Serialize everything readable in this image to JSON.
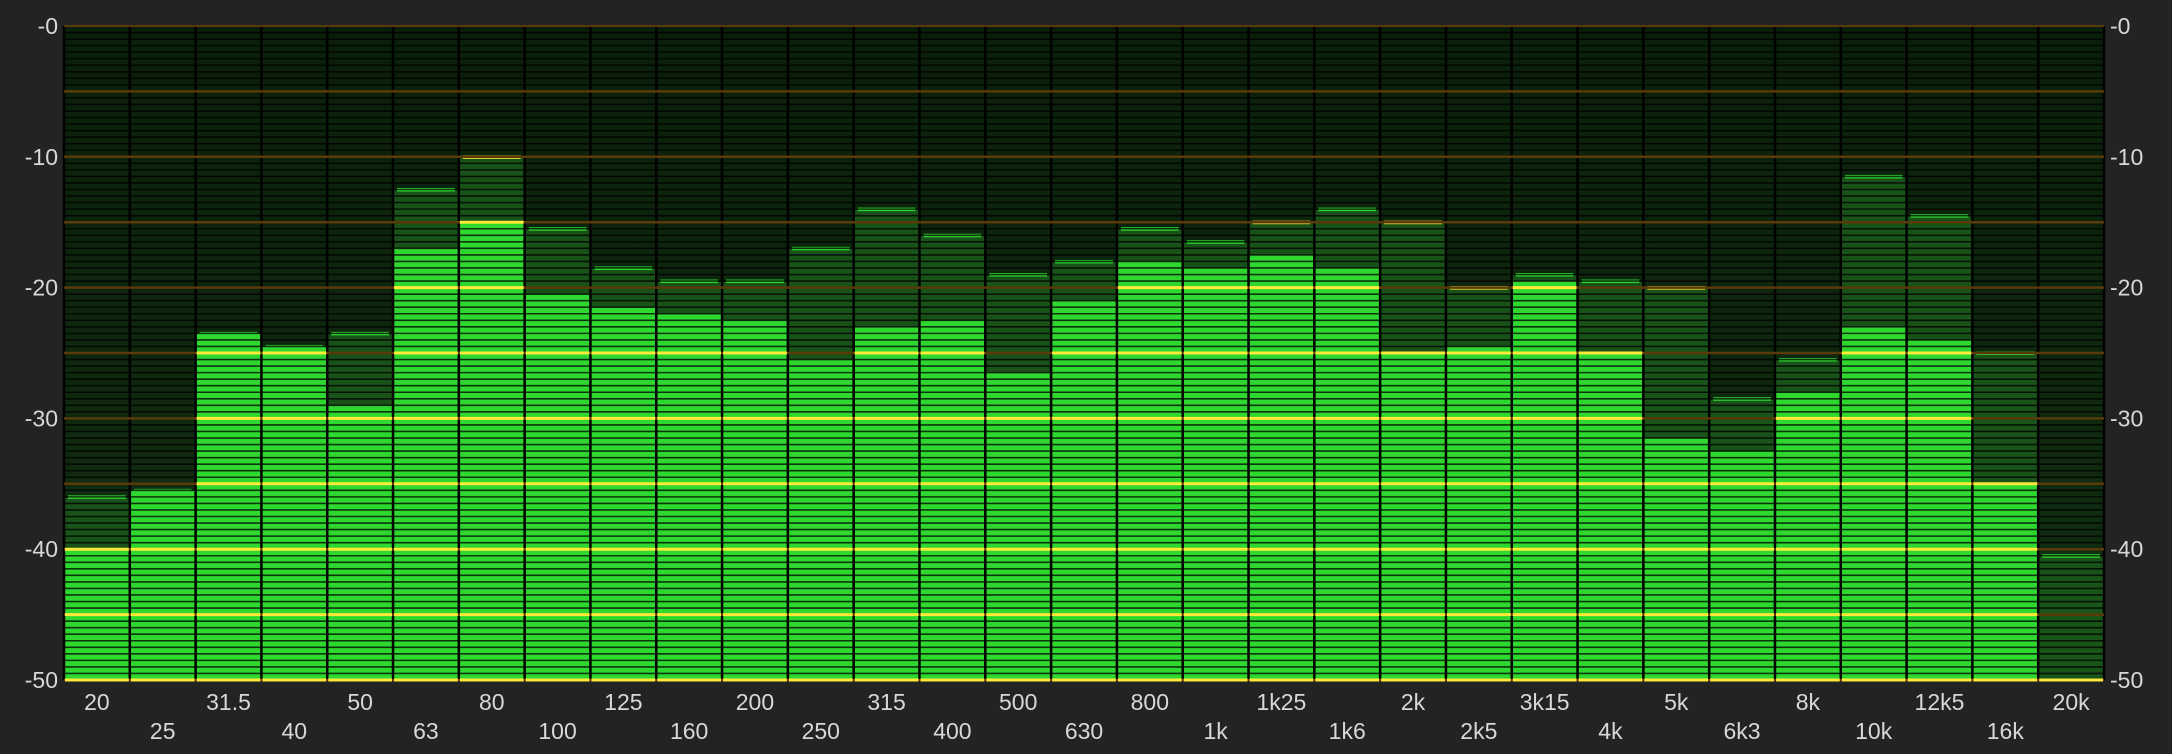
{
  "chart_data": {
    "type": "bar",
    "ylim": [
      -50,
      0
    ],
    "y_ticks": [
      0,
      -10,
      -20,
      -30,
      -40,
      -50
    ],
    "y_tick_labels": [
      "-0",
      "-10",
      "-20",
      "-30",
      "-40",
      "-50"
    ],
    "categories": [
      "20",
      "25",
      "31.5",
      "40",
      "50",
      "63",
      "80",
      "100",
      "125",
      "160",
      "200",
      "250",
      "315",
      "400",
      "500",
      "630",
      "800",
      "1k",
      "1k25",
      "1k6",
      "2k",
      "2k5",
      "3k15",
      "4k",
      "5k",
      "6k3",
      "8k",
      "10k",
      "12k5",
      "16k",
      "20k"
    ],
    "series": [
      {
        "values": [
          -40,
          -35.5,
          -23.5,
          -24.5,
          -29,
          -17,
          -15,
          -20.5,
          -21.5,
          -22,
          -22.5,
          -25.5,
          -23,
          -22.5,
          -26.5,
          -21,
          -18,
          -18.5,
          -17.5,
          -18.5,
          -25,
          -24.5,
          -19.5,
          -25,
          -31.5,
          -32.5,
          -28,
          -23,
          -24,
          -35,
          -50
        ]
      },
      {
        "values": [
          -36,
          -35.5,
          -23.5,
          -24.5,
          -23.5,
          -12.5,
          -10,
          -15.5,
          -18.5,
          -19.5,
          -19.5,
          -17,
          -14,
          -16,
          -19,
          -18,
          -15.5,
          -16.5,
          -15,
          -14,
          -15,
          -20,
          -19,
          -19.5,
          -20,
          -28.5,
          -25.5,
          -11.5,
          -14.5,
          -25,
          -40.5
        ]
      }
    ],
    "colors": {
      "background": "#232323",
      "lit": "#2fd82f",
      "hold": "#2fd82f",
      "hold_peak": "#ffe93a",
      "unlit": "#0c260c",
      "ref_line": "#ffe93a",
      "text": "#d8d8d8"
    },
    "grid": true
  }
}
